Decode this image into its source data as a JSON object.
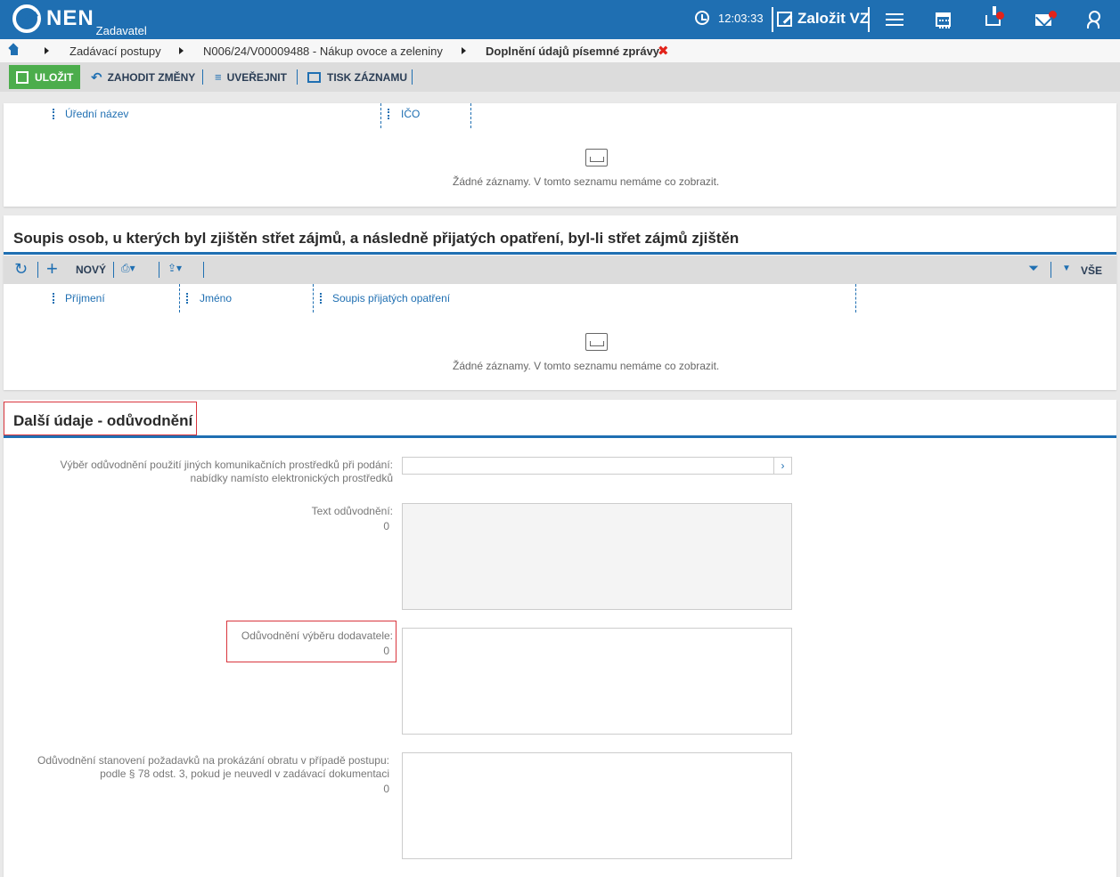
{
  "header": {
    "logo_text": "NEN",
    "logo_sub": "Zadavatel",
    "time": "12:03:33",
    "create_label": "Založit VZ"
  },
  "breadcrumb": {
    "items": [
      "Zadávací postupy",
      "N006/24/V00009488 - Nákup ovoce a zeleniny",
      "Doplnění údajů písemné zprávy"
    ],
    "close_symbol": "✖"
  },
  "toolbar": {
    "save_label": "ULOŽIT",
    "discard_label": "ZAHODIT ZMĚNY",
    "publish_label": "UVEŘEJNIT",
    "print_label": "TISK ZÁZNAMU"
  },
  "grid1": {
    "columns": [
      "Úřední název",
      "IČO"
    ],
    "empty_text": "Žádné záznamy. V tomto seznamu nemáme co zobrazit."
  },
  "grid2": {
    "title": "Soupis osob, u kterých byl zjištěn střet zájmů, a následně přijatých opatření, byl-li střet zájmů zjištěn",
    "new_label": "NOVÝ",
    "all_label": "VŠE",
    "columns": [
      "Příjmení",
      "Jméno",
      "Soupis přijatých opatření"
    ],
    "empty_text": "Žádné záznamy. V tomto seznamu nemáme co zobrazit."
  },
  "section3": {
    "title": "Další údaje - odůvodnění",
    "fields": [
      {
        "label_line1": "Výběr odůvodnění použití jiných komunikačních prostředků při podání:",
        "label_line2": "nabídky namísto elektronických prostředků",
        "value": ""
      },
      {
        "label_line1": "Text odůvodnění:",
        "count": "0"
      },
      {
        "label_line1": "Odůvodnění výběru dodavatele:",
        "count": "0"
      },
      {
        "label_line1": "Odůvodnění stanovení požadavků na prokázání obratu v případě postupu:",
        "label_line2": "podle § 78 odst. 3, pokud je neuvedl v zadávací dokumentaci",
        "count": "0"
      }
    ]
  },
  "colors": {
    "brand_blue": "#1f6fb2",
    "save_green": "#4cad4c",
    "error_red": "#e2231a"
  }
}
